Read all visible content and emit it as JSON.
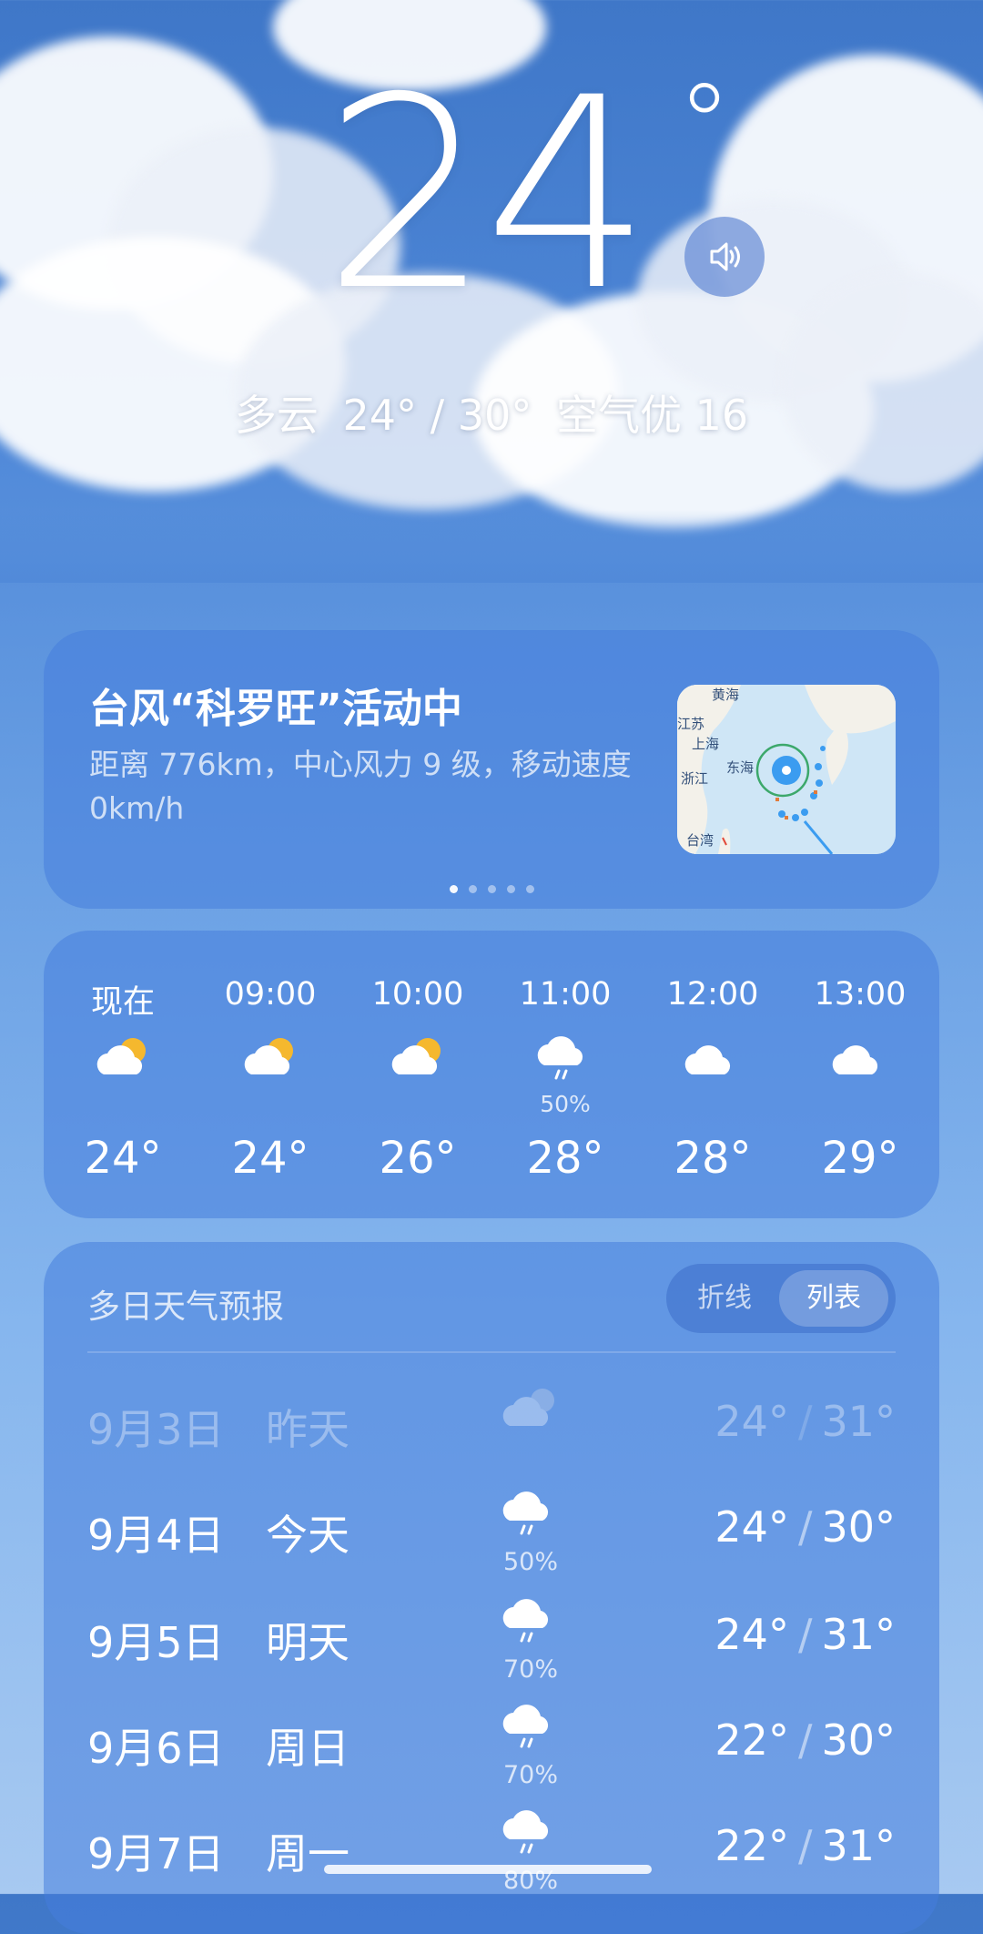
{
  "current": {
    "temperature": "24",
    "degree_symbol": "°",
    "condition": "多云",
    "range": "24° / 30°",
    "air_quality": "空气优 16"
  },
  "typhoon_card": {
    "title": "台风“科罗旺”活动中",
    "description": "距离 776km，中心风力 9 级，移动速度 0km/h",
    "map_labels": [
      "黄海",
      "江苏",
      "上海",
      "浙江",
      "东海",
      "台湾"
    ],
    "page_dots": 5,
    "active_dot": 0
  },
  "hourly": [
    {
      "time": "现在",
      "icon": "partly-cloudy-icon",
      "pop": "",
      "temp": "24°"
    },
    {
      "time": "09:00",
      "icon": "partly-cloudy-icon",
      "pop": "",
      "temp": "24°"
    },
    {
      "time": "10:00",
      "icon": "partly-cloudy-icon",
      "pop": "",
      "temp": "26°"
    },
    {
      "time": "11:00",
      "icon": "rain-icon",
      "pop": "50%",
      "temp": "28°"
    },
    {
      "time": "12:00",
      "icon": "cloudy-icon",
      "pop": "",
      "temp": "28°"
    },
    {
      "time": "13:00",
      "icon": "cloudy-icon",
      "pop": "",
      "temp": "29°"
    }
  ],
  "daily": {
    "title": "多日天气预报",
    "toggle": {
      "chart_label": "折线",
      "list_label": "列表",
      "selected": "列表"
    },
    "rows": [
      {
        "date": "9月3日",
        "day": "昨天",
        "icon": "cloudy-night-icon",
        "pop": "",
        "low": "24°",
        "high": "31°",
        "past": true
      },
      {
        "date": "9月4日",
        "day": "今天",
        "icon": "rain-icon",
        "pop": "50%",
        "low": "24°",
        "high": "30°",
        "past": false
      },
      {
        "date": "9月5日",
        "day": "明天",
        "icon": "rain-icon",
        "pop": "70%",
        "low": "24°",
        "high": "31°",
        "past": false
      },
      {
        "date": "9月6日",
        "day": "周日",
        "icon": "rain-icon",
        "pop": "70%",
        "low": "22°",
        "high": "30°",
        "past": false
      },
      {
        "date": "9月7日",
        "day": "周一",
        "icon": "rain-icon",
        "pop": "80%",
        "low": "22°",
        "high": "31°",
        "past": false
      }
    ]
  }
}
